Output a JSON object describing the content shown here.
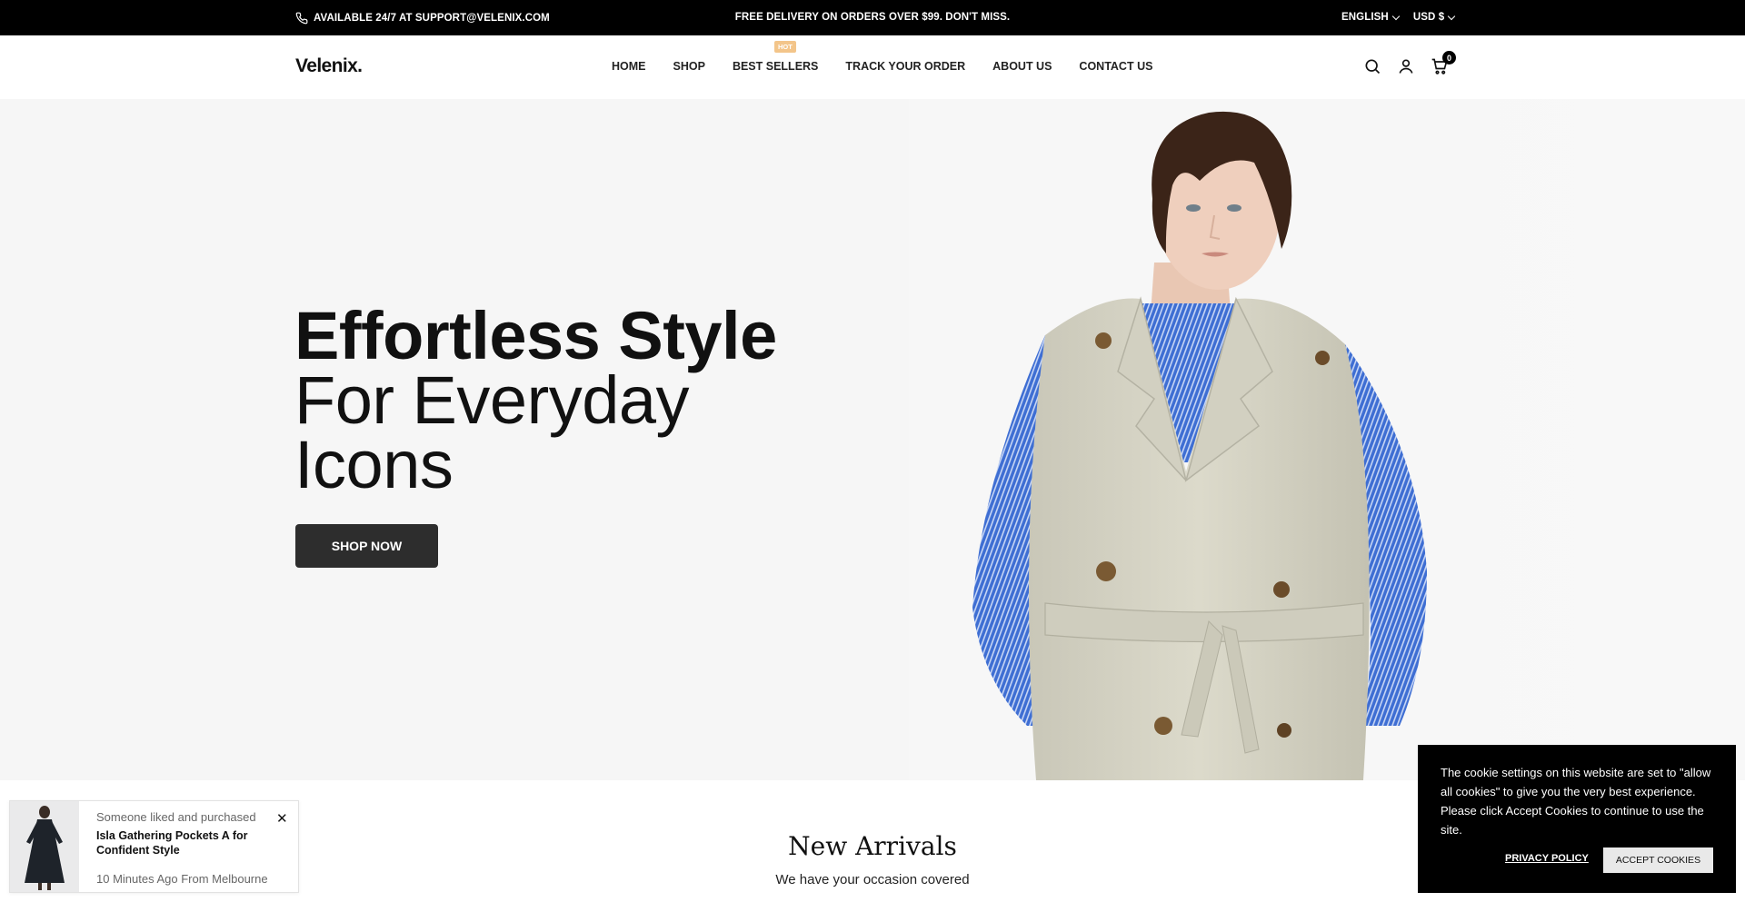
{
  "topbar": {
    "contact": "AVAILABLE 24/7 AT SUPPORT@VELENIX.COM",
    "promo": "FREE DELIVERY ON ORDERS OVER $99. DON'T MISS.",
    "language": "ENGLISH",
    "currency": "USD $"
  },
  "header": {
    "logo": "Velenix.",
    "nav": [
      "HOME",
      "SHOP",
      "BEST SELLERS",
      "TRACK YOUR ORDER",
      "ABOUT US",
      "CONTACT US"
    ],
    "nav_badge": "HOT",
    "cart_count": "0"
  },
  "hero": {
    "title_bold": "Effortless Style",
    "title_line2": "For Everyday",
    "title_line3": "Icons",
    "cta": "SHOP NOW"
  },
  "section": {
    "title": "New Arrivals",
    "subtitle": "We have your occasion covered"
  },
  "popup": {
    "line1": "Someone liked and purchased",
    "product": "Isla Gathering Pockets A for Confident Style",
    "line3": "10 Minutes Ago From Melbourne"
  },
  "cookie": {
    "message": "The cookie settings on this website are set to \"allow all cookies\" to give you the very best experience. Please click Accept Cookies to continue to use the site.",
    "privacy": "PRIVACY POLICY",
    "accept": "ACCEPT COOKIES"
  }
}
